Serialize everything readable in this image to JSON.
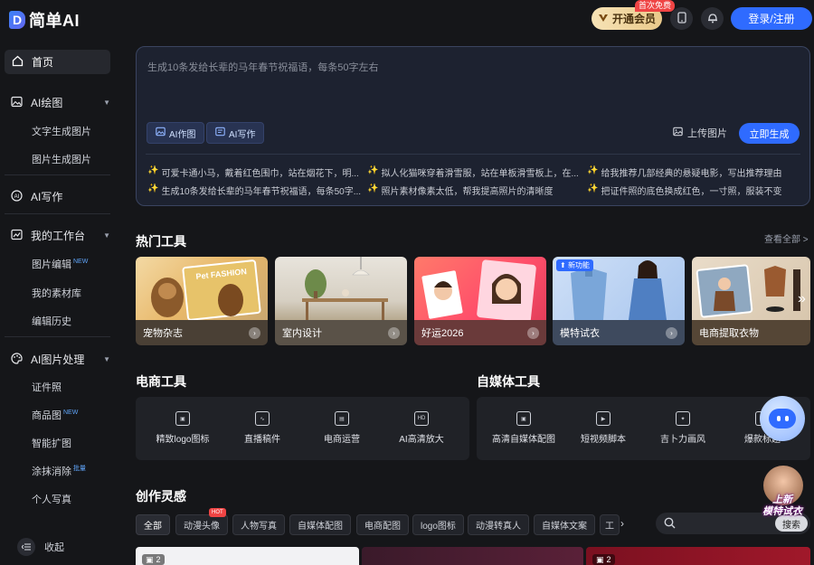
{
  "header": {
    "logo_mark": "D",
    "logo_text": "简单AI",
    "vip_label": "开通会员",
    "vip_badge": "首次免费",
    "login_label": "登录/注册"
  },
  "sidebar": {
    "home": "首页",
    "groups": [
      {
        "label": "AI绘图",
        "items": [
          {
            "label": "文字生成图片",
            "tag": ""
          },
          {
            "label": "图片生成图片",
            "tag": ""
          }
        ]
      },
      {
        "label": "AI写作",
        "items": []
      },
      {
        "label": "我的工作台",
        "items": [
          {
            "label": "图片编辑",
            "tag": "NEW"
          },
          {
            "label": "我的素材库",
            "tag": ""
          },
          {
            "label": "编辑历史",
            "tag": ""
          }
        ]
      },
      {
        "label": "AI图片处理",
        "items": [
          {
            "label": "证件照",
            "tag": ""
          },
          {
            "label": "商品图",
            "tag": "NEW"
          },
          {
            "label": "智能扩图",
            "tag": ""
          },
          {
            "label": "涂抹消除",
            "tag": "批量"
          },
          {
            "label": "个人写真",
            "tag": ""
          }
        ]
      }
    ],
    "collapse": "收起"
  },
  "prompt": {
    "placeholder": "生成10条发给长辈的马年春节祝福语，每条50字左右",
    "chip_draw": "AI作图",
    "chip_write": "AI写作",
    "upload": "上传图片",
    "generate": "立即生成",
    "suggestions": [
      "可爱卡通小马，戴着红色围巾，站在烟花下，明...",
      "拟人化猫咪穿着滑雪服，站在单板滑雪板上，在...",
      "给我推荐几部经典的悬疑电影，写出推荐理由",
      "生成10条发给长辈的马年春节祝福语，每条50字...",
      "照片素材像素太低，帮我提高照片的清晰度",
      "把证件照的底色换成红色，一寸照，服装不变"
    ]
  },
  "hot_tools": {
    "title": "热门工具",
    "see_all": "查看全部 >",
    "cards": [
      {
        "label": "宠物杂志",
        "tag": "",
        "art": "Pet FASHION"
      },
      {
        "label": "室内设计",
        "tag": "",
        "art": ""
      },
      {
        "label": "好运2026",
        "tag": "",
        "art": ""
      },
      {
        "label": "模特试衣",
        "tag": "新功能",
        "art": ""
      },
      {
        "label": "电商提取衣物",
        "tag": "",
        "art": ""
      }
    ]
  },
  "ecommerce": {
    "title": "电商工具",
    "items": [
      "精致logo图标",
      "直播稿件",
      "电商运营",
      "AI高清放大"
    ]
  },
  "media": {
    "title": "自媒体工具",
    "items": [
      "高清自媒体配图",
      "短视频脚本",
      "吉卜力画风",
      "爆款标题"
    ]
  },
  "inspiration": {
    "title": "创作灵感",
    "tabs": [
      "全部",
      "动漫头像",
      "人物写真",
      "自媒体配图",
      "电商配图",
      "logo图标",
      "动漫转真人",
      "自媒体文案",
      "工"
    ],
    "hot_badge": "HOT",
    "search_button": "搜索",
    "gallery_counts": [
      "2",
      "2"
    ]
  },
  "promo": {
    "line1": "上新",
    "line2": "模特试衣"
  }
}
